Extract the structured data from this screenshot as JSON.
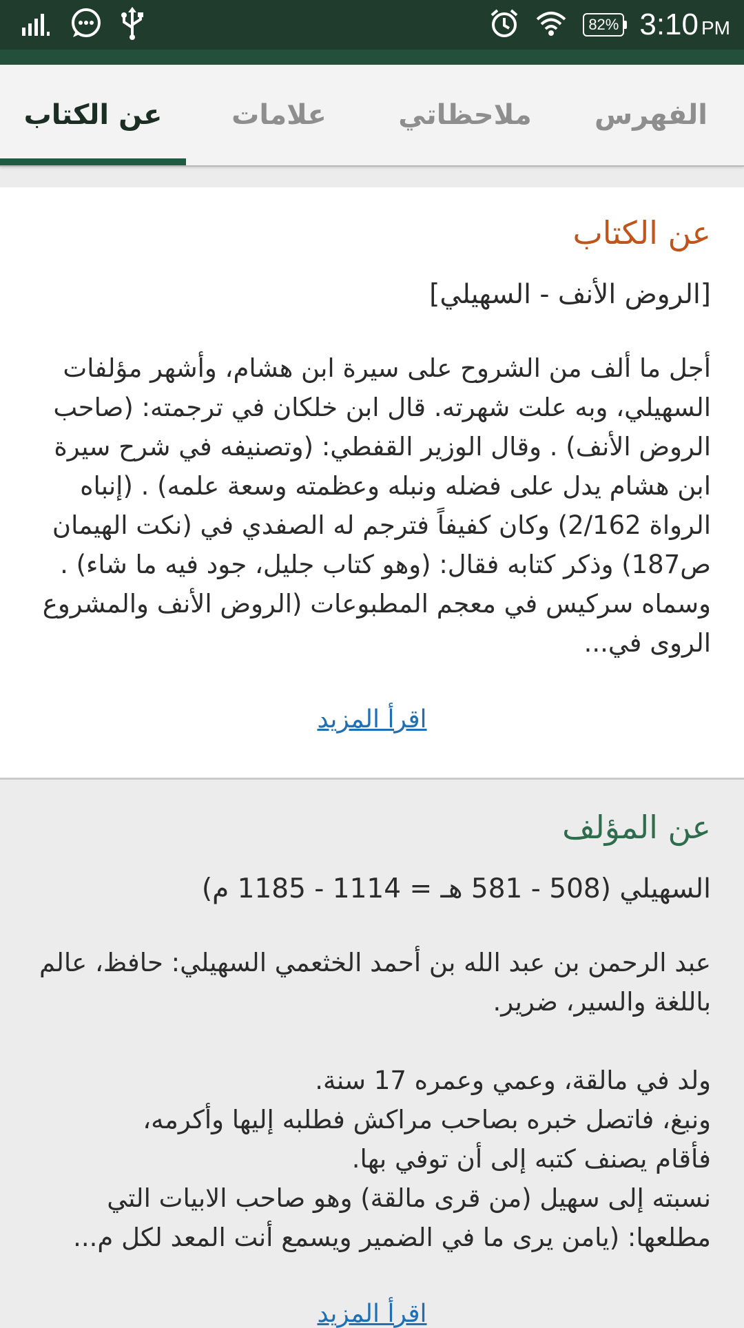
{
  "status_bar": {
    "battery": "82%",
    "time": "3:10",
    "ampm": "PM",
    "icons": [
      "signal-icon",
      "chat-icon",
      "usb-icon",
      "alarm-icon",
      "wifi-icon",
      "battery-icon"
    ]
  },
  "tabs": [
    {
      "label": "الفهرس"
    },
    {
      "label": "ملاحظاتي"
    },
    {
      "label": "علامات"
    },
    {
      "label": "عن الكتاب",
      "active": true
    }
  ],
  "about_book": {
    "title": "عن الكتاب",
    "subtitle": "[الروض الأنف - السهيلي]",
    "body": "أجل ما ألف من الشروح على سيرة ابن هشام، وأشهر مؤلفات السهيلي، وبه علت شهرته. قال ابن خلكان في ترجمته: (صاحب الروض الأنف) . وقال الوزير القفطي: (وتصنيفه في شرح سيرة ابن هشام يدل على فضله ونبله وعظمته وسعة علمه) . (إنباه الرواة 2/162) وكان كفيفاً فترجم له الصفدي في (نكت الهيمان ص187) وذكر كتابه فقال: (وهو كتاب جليل، جود فيه ما شاء) . وسماه سركيس في معجم المطبوعات (الروض الأنف والمشروع الروى في...",
    "read_more": "اقرأ المزيد"
  },
  "about_author": {
    "title": "عن المؤلف",
    "subtitle": "السهيلي (508 - 581 هـ = 1114 - 1185 م)",
    "para1": "عبد الرحمن بن عبد الله بن أحمد الخثعمي السهيلي: حافظ، عالم باللغة والسير، ضرير.",
    "para2_lines": [
      "ولد في مالقة، وعمي وعمره 17 سنة.",
      "ونبغ، فاتصل خبره بصاحب مراكش فطلبه إليها وأكرمه،",
      "فأقام يصنف كتبه إلى أن توفي بها.",
      "نسبته إلى سهيل (من قرى مالقة) وهو صاحب الابيات التي مطلعها: (يامن يرى ما في الضمير ويسمع أنت المعد لكل م..."
    ],
    "read_more": "اقرأ المزيد"
  }
}
